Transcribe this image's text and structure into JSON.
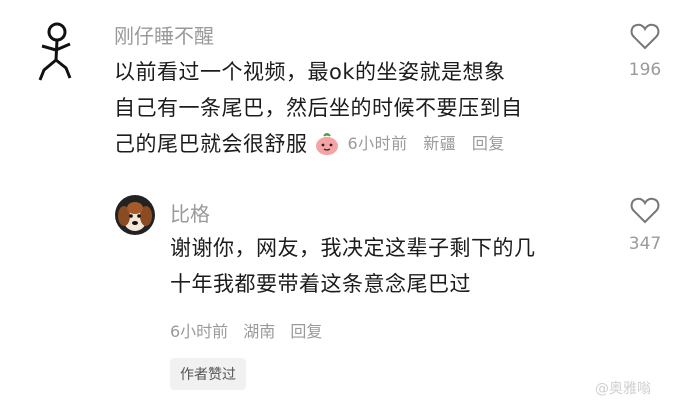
{
  "comments": [
    {
      "username": "刚仔睡不醒",
      "avatar": "stick-figure-avatar",
      "lines": [
        "以前看过一个视频，最ok的坐姿就是想象",
        "自己有一条尾巴，然后坐的时候不要压到自",
        "己的尾巴就会很舒服"
      ],
      "emoji": "peach-emoji",
      "time": "6小时前",
      "location": "新疆",
      "reply_label": "回复",
      "likes": "196"
    },
    {
      "username": "比格",
      "avatar": "beagle-avatar",
      "lines": [
        "谢谢你，网友，我决定这辈子剩下的几",
        "十年我都要带着这条意念尾巴过"
      ],
      "time": "6小时前",
      "location": "湖南",
      "reply_label": "回复",
      "likes": "347",
      "badge": "作者赞过"
    }
  ],
  "watermark": "@奥雅嗡"
}
